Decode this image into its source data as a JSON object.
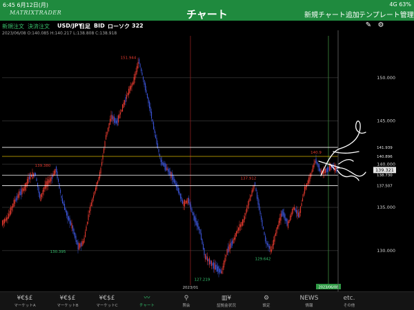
{
  "status": {
    "time": "6:45",
    "date": "6月12日(月)",
    "signal": "4G 63%"
  },
  "app": {
    "logo": "MATRIXTRADER",
    "title": "チャート",
    "action_new_chart": "新規チャート追加",
    "action_template": "テンプレート管理"
  },
  "toolbar": {
    "new_order": "新規注文",
    "settle_order": "決済注文",
    "pair": "USD/JPY",
    "period": "日足",
    "side": "BID",
    "candle": "ローソク",
    "count": "322"
  },
  "ohlc_line": "2023/06/08 O:140.085 H:140.217 L:138.808 C:138.918",
  "colors": {
    "up": "#e53a2e",
    "down": "#3b54d6",
    "green": "#36c46f",
    "yellow": "#d9b400",
    "white": "#ffffff"
  },
  "chart_data": {
    "type": "candlestick",
    "y_ticks": [
      130.0,
      135.0,
      140.0,
      145.0,
      150.0
    ],
    "y_tick_labels": [
      "130.000",
      "135.000",
      "140.000",
      "145.000",
      "150.000"
    ],
    "ylim": [
      126.0,
      155.0
    ],
    "annotations": [
      {
        "text": "151.944",
        "value": 151.944,
        "color": "red"
      },
      {
        "text": "139.380",
        "value": 139.38,
        "color": "red"
      },
      {
        "text": "130.395",
        "value": 130.395,
        "color": "green"
      },
      {
        "text": "127.219",
        "value": 127.219,
        "color": "green"
      },
      {
        "text": "137.912",
        "value": 137.912,
        "color": "red"
      },
      {
        "text": "129.642",
        "value": 129.642,
        "color": "green"
      },
      {
        "text": "140.9",
        "value": 140.9,
        "color": "red"
      }
    ],
    "horizontal_lines": [
      {
        "value": 141.939,
        "label": "141.939",
        "color": "white"
      },
      {
        "value": 140.896,
        "label": "140.896",
        "color": "yellow"
      },
      {
        "value": 138.73,
        "label": "138.730",
        "color": "white"
      },
      {
        "value": 137.507,
        "label": "137.507",
        "color": "white"
      }
    ],
    "current_price": "139.321",
    "date_markers": {
      "left": "2023/01",
      "right": "2023/06/08"
    },
    "trend": [
      [
        0,
        133.2
      ],
      [
        8,
        133.8
      ],
      [
        16,
        135.4
      ],
      [
        24,
        136.5
      ],
      [
        32,
        137.2
      ],
      [
        40,
        138.6
      ],
      [
        48,
        138.8
      ],
      [
        55,
        136.0
      ],
      [
        62,
        137.5
      ],
      [
        70,
        138.2
      ],
      [
        78,
        139.4
      ],
      [
        86,
        136.0
      ],
      [
        94,
        134.1
      ],
      [
        102,
        132.6
      ],
      [
        110,
        130.4
      ],
      [
        118,
        131.0
      ],
      [
        126,
        134.5
      ],
      [
        134,
        136.8
      ],
      [
        142,
        139.0
      ],
      [
        150,
        143.1
      ],
      [
        158,
        145.5
      ],
      [
        166,
        144.8
      ],
      [
        174,
        146.5
      ],
      [
        182,
        148.2
      ],
      [
        190,
        149.5
      ],
      [
        198,
        151.9
      ],
      [
        206,
        149.3
      ],
      [
        214,
        146.5
      ],
      [
        222,
        143.2
      ],
      [
        230,
        140.3
      ],
      [
        238,
        139.5
      ],
      [
        246,
        138.6
      ],
      [
        254,
        137.2
      ],
      [
        262,
        135.4
      ],
      [
        270,
        135.8
      ],
      [
        278,
        133.8
      ],
      [
        286,
        132.4
      ],
      [
        294,
        129.3
      ],
      [
        302,
        128.6
      ],
      [
        310,
        128.0
      ],
      [
        318,
        127.5
      ],
      [
        326,
        130.0
      ],
      [
        334,
        131.0
      ],
      [
        342,
        132.5
      ],
      [
        350,
        133.5
      ],
      [
        358,
        135.8
      ],
      [
        366,
        137.7
      ],
      [
        374,
        134.2
      ],
      [
        382,
        131.0
      ],
      [
        390,
        130.0
      ],
      [
        398,
        132.5
      ],
      [
        406,
        134.5
      ],
      [
        414,
        133.0
      ],
      [
        422,
        135.0
      ],
      [
        430,
        134.0
      ],
      [
        438,
        137.0
      ],
      [
        446,
        138.5
      ],
      [
        454,
        140.5
      ],
      [
        462,
        139.0
      ],
      [
        470,
        139.3
      ],
      [
        478,
        139.8
      ],
      [
        485,
        139.3
      ]
    ]
  },
  "nav": [
    {
      "icon": "¥€$£",
      "label": "マーケットA"
    },
    {
      "icon": "¥€$£",
      "label": "マーケットB"
    },
    {
      "icon": "¥€$£",
      "label": "マーケットC"
    },
    {
      "icon": "〰",
      "label": "チャート"
    },
    {
      "icon": "⚲",
      "label": "照会"
    },
    {
      "icon": "▥¥",
      "label": "証拠金状況"
    },
    {
      "icon": "⚙",
      "label": "設定"
    },
    {
      "icon": "NEWS",
      "label": "情報"
    },
    {
      "icon": "etc.",
      "label": "その他"
    }
  ]
}
